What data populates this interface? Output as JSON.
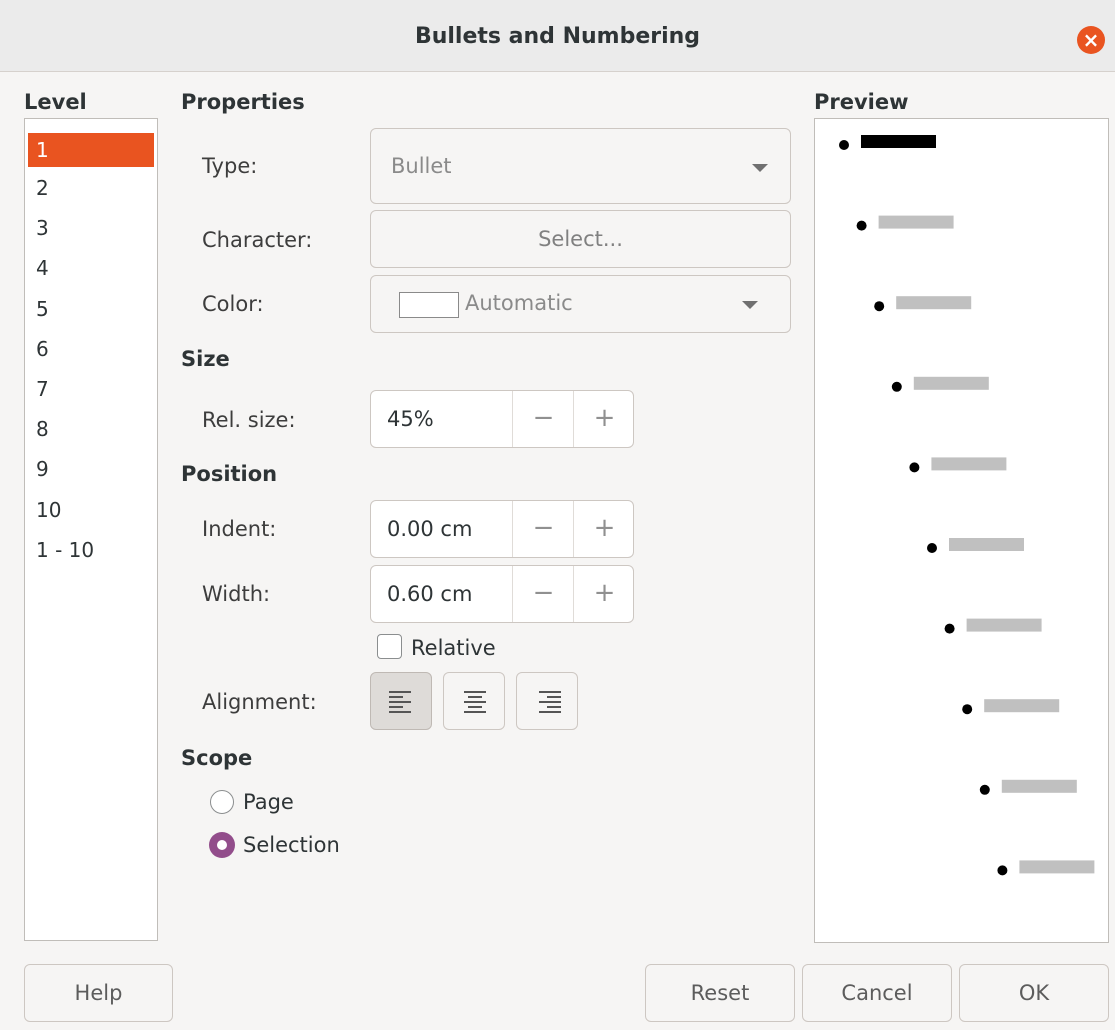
{
  "dialog": {
    "title": "Bullets and Numbering"
  },
  "level": {
    "heading": "Level",
    "items": [
      "1",
      "2",
      "3",
      "4",
      "5",
      "6",
      "7",
      "8",
      "9",
      "10",
      "1 - 10"
    ],
    "selected": "1"
  },
  "properties": {
    "heading": "Properties",
    "type_label": "Type:",
    "type_value": "Bullet",
    "character_label": "Character:",
    "character_button": "Select...",
    "color_label": "Color:",
    "color_value": "Automatic"
  },
  "size": {
    "heading": "Size",
    "rel_size_label": "Rel. size:",
    "rel_size_value": "45%"
  },
  "position": {
    "heading": "Position",
    "indent_label": "Indent:",
    "indent_value": "0.00 cm",
    "width_label": "Width:",
    "width_value": "0.60 cm",
    "relative_label": "Relative",
    "relative_checked": false,
    "alignment_label": "Alignment:",
    "alignment_selected": "left"
  },
  "scope": {
    "heading": "Scope",
    "page_label": "Page",
    "selection_label": "Selection",
    "selected": "Selection"
  },
  "preview": {
    "heading": "Preview"
  },
  "spin": {
    "minus": "−",
    "plus": "+"
  },
  "footer": {
    "help": "Help",
    "reset": "Reset",
    "cancel": "Cancel",
    "ok": "OK"
  },
  "colors": {
    "accent": "#e95420",
    "radio": "#924d8b",
    "preview_active": "#000000",
    "preview_inactive": "#c0c0c0"
  }
}
